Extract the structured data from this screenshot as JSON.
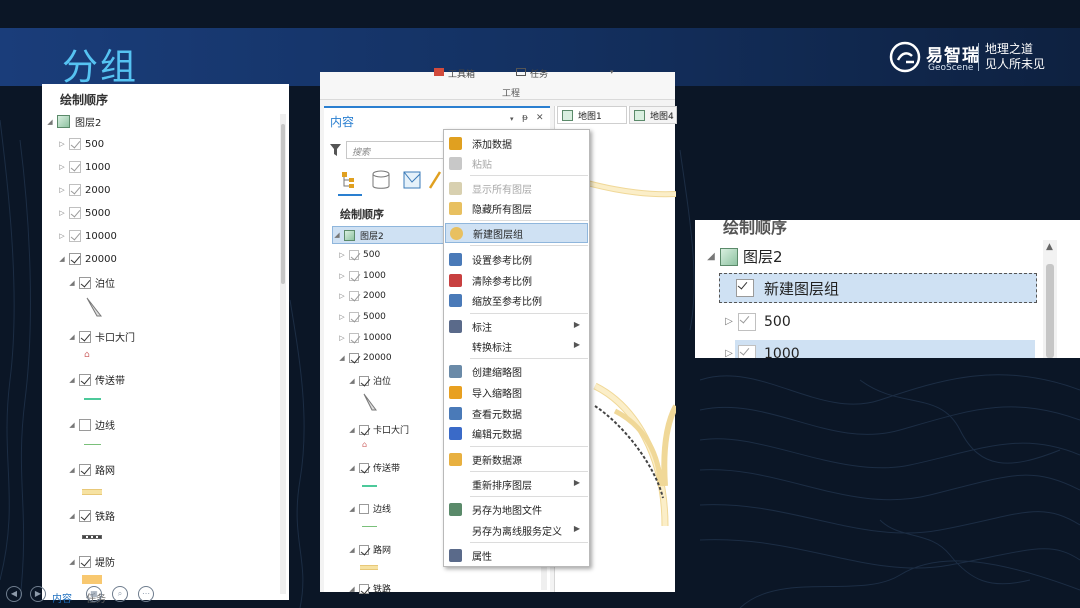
{
  "slide": {
    "title": "分组",
    "brand": {
      "name": "易智瑞",
      "sub": "GeoScene",
      "slogan_line1": "地理之道",
      "slogan_line2": "见人所未见"
    }
  },
  "left_panel": {
    "header": "绘制顺序",
    "root": "图层2",
    "scales": [
      "500",
      "1000",
      "2000",
      "5000",
      "10000",
      "20000"
    ],
    "children": [
      "泊位",
      "卡口大门",
      "传送带",
      "边线",
      "路网",
      "铁路",
      "堤防"
    ],
    "footer_tabs": [
      "内容",
      "任务"
    ]
  },
  "app_window": {
    "ribbon": {
      "toolbox": "工具箱",
      "tasks": "任务",
      "group_label": "工程"
    },
    "contents_title": "内容",
    "pane_controls": {
      "pin": "ᵽ",
      "close": "✕"
    },
    "search_placeholder": "搜索",
    "map_tabs": [
      "地图1",
      "地图4"
    ],
    "section_header": "绘制顺序",
    "root": "图层2",
    "scales": [
      "500",
      "1000",
      "2000",
      "5000",
      "10000",
      "20000"
    ],
    "children": [
      "泊位",
      "卡口大门",
      "传送带",
      "边线",
      "路网",
      "铁路"
    ]
  },
  "context_menu": {
    "items": [
      {
        "label": "添加数据",
        "enabled": true,
        "icon": "add-data-icon",
        "color": "#e0a020"
      },
      {
        "label": "粘贴",
        "enabled": false,
        "icon": "paste-icon",
        "color": "#c8c8c8"
      },
      {
        "label": "显示所有图层",
        "enabled": false,
        "icon": "show-layers-icon",
        "color": "#d8d0b0"
      },
      {
        "label": "隐藏所有图层",
        "enabled": true,
        "icon": "hide-layers-icon",
        "color": "#e8c060"
      },
      {
        "label": "新建图层组",
        "enabled": true,
        "icon": "new-group-icon",
        "color": "#e8c060",
        "highlighted": true
      },
      {
        "label": "设置参考比例",
        "enabled": true,
        "icon": "set-scale-icon",
        "color": "#4a7ab8"
      },
      {
        "label": "清除参考比例",
        "enabled": true,
        "icon": "clear-scale-icon",
        "color": "#c84040"
      },
      {
        "label": "缩放至参考比例",
        "enabled": true,
        "icon": "zoom-scale-icon",
        "color": "#4a7ab8"
      },
      {
        "label": "标注",
        "enabled": true,
        "icon": "label-icon",
        "color": "#5a6a8a",
        "submenu": true
      },
      {
        "label": "转换标注",
        "enabled": true,
        "icon": "",
        "color": "",
        "submenu": true
      },
      {
        "label": "创建缩略图",
        "enabled": true,
        "icon": "create-thumbnail-icon",
        "color": "#6a8aa8"
      },
      {
        "label": "导入缩略图",
        "enabled": true,
        "icon": "import-thumbnail-icon",
        "color": "#e8a020"
      },
      {
        "label": "查看元数据",
        "enabled": true,
        "icon": "view-metadata-icon",
        "color": "#4a7ab8"
      },
      {
        "label": "编辑元数据",
        "enabled": true,
        "icon": "edit-metadata-icon",
        "color": "#3a6ac8"
      },
      {
        "label": "更新数据源",
        "enabled": true,
        "icon": "update-source-icon",
        "color": "#e8b040"
      },
      {
        "label": "重新排序图层",
        "enabled": true,
        "icon": "",
        "color": "",
        "submenu": true
      },
      {
        "label": "另存为地图文件",
        "enabled": true,
        "icon": "save-map-file-icon",
        "color": "#5a8a6a"
      },
      {
        "label": "另存为离线服务定义",
        "enabled": true,
        "icon": "",
        "color": "",
        "submenu": true
      },
      {
        "label": "属性",
        "enabled": true,
        "icon": "properties-icon",
        "color": "#5a6a8a"
      }
    ]
  },
  "zoom_panel": {
    "header": "绘制顺序",
    "root": "图层2",
    "new_group": "新建图层组",
    "items": [
      "500",
      "1000"
    ]
  },
  "bottom_controls": [
    "◀",
    "▶",
    "▦",
    "⌕",
    "⋯"
  ]
}
